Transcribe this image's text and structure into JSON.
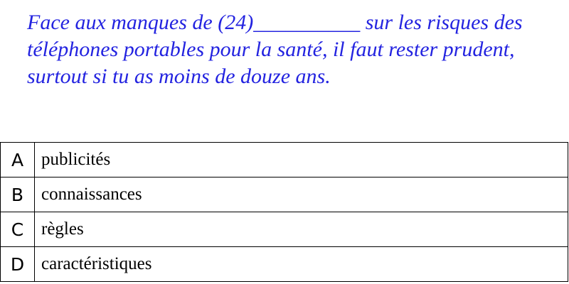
{
  "question": {
    "text": "Face aux manques de (24)__________ sur les risques des téléphones portables pour la santé, il faut rester prudent, surtout si tu as moins de douze ans."
  },
  "options": [
    {
      "letter": "A",
      "text": "publicités"
    },
    {
      "letter": "B",
      "text": "connaissances"
    },
    {
      "letter": "C",
      "text": "règles"
    },
    {
      "letter": "D",
      "text": "caractéristiques"
    }
  ],
  "colors": {
    "question_text": "#2323e0",
    "border": "#000000"
  }
}
